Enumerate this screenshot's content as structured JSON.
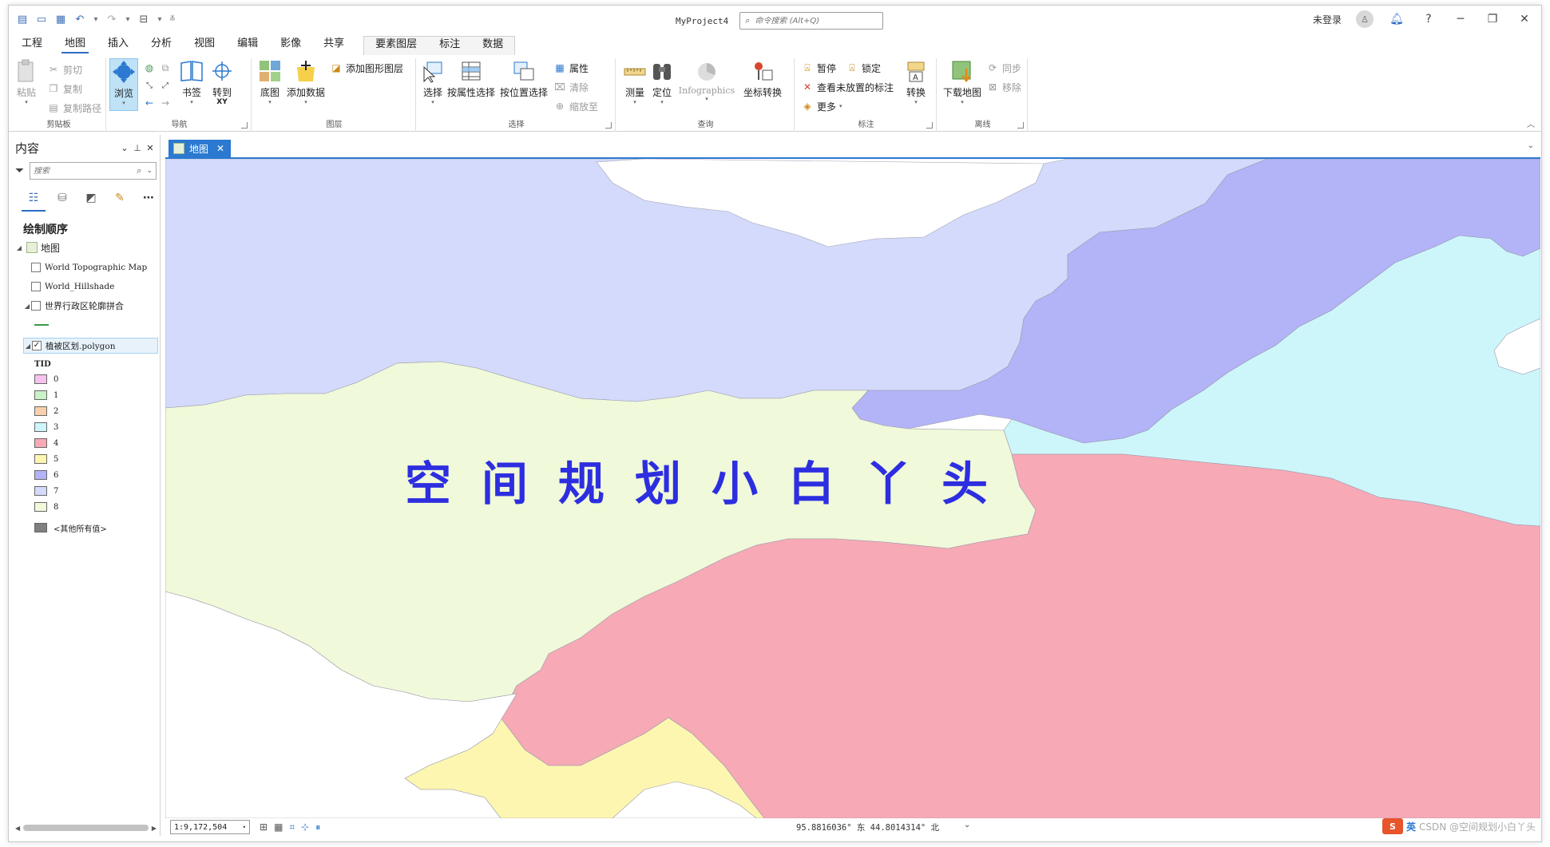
{
  "app": {
    "project_name": "MyProject4",
    "command_search_placeholder": "命令搜索 (Alt+Q)",
    "login_label": "未登录",
    "help": "?"
  },
  "tabs": [
    "工程",
    "地图",
    "插入",
    "分析",
    "视图",
    "编辑",
    "影像",
    "共享"
  ],
  "context_tabs": [
    "要素图层",
    "标注",
    "数据"
  ],
  "active_tab": "地图",
  "ribbon": {
    "clipboard": {
      "paste": "粘贴",
      "cut": "剪切",
      "copy": "复制",
      "copy_path": "复制路径",
      "label": "剪贴板"
    },
    "navigate": {
      "explore": "浏览",
      "bookmarks": "书签",
      "go_to_xy": "转到",
      "go_to_xy_sub": "XY",
      "label": "导航"
    },
    "layer": {
      "basemap": "底图",
      "add_data": "添加数据",
      "add_graphics_layer": "添加图形图层",
      "label": "图层"
    },
    "selection": {
      "select": "选择",
      "select_by_attributes": "按属性选择",
      "select_by_location": "按位置选择",
      "attributes": "属性",
      "clear": "清除",
      "zoom_to": "缩放至",
      "label": "选择"
    },
    "inquiry": {
      "measure": "测量",
      "locate": "定位",
      "infographics": "Infographics",
      "convert_coordinates": "坐标转换",
      "label": "查询"
    },
    "labeling": {
      "pause": "暂停",
      "lock": "锁定",
      "view_unplaced": "查看未放置的标注",
      "more": "更多",
      "convert": "转换",
      "label": "标注"
    },
    "offline": {
      "download_map": "下载地图",
      "sync": "同步",
      "remove": "移除",
      "label": "离线"
    }
  },
  "contents": {
    "title": "内容",
    "search_placeholder": "搜索",
    "section": "绘制顺序",
    "map_name": "地图",
    "layers": [
      {
        "name": "World Topographic Map",
        "checked": false
      },
      {
        "name": "World_Hillshade",
        "checked": false
      },
      {
        "name": "世界行政区轮廓拼合",
        "checked": false
      },
      {
        "name": "植被区划.polygon",
        "checked": true
      }
    ],
    "legend_field": "TID",
    "legend": [
      {
        "label": "0",
        "color": "#f6c3f0"
      },
      {
        "label": "1",
        "color": "#c9f2c7"
      },
      {
        "label": "2",
        "color": "#f9cfae"
      },
      {
        "label": "3",
        "color": "#cdf6fb"
      },
      {
        "label": "4",
        "color": "#f7a9b6"
      },
      {
        "label": "5",
        "color": "#fdf6b0"
      },
      {
        "label": "6",
        "color": "#b3b3f8"
      },
      {
        "label": "7",
        "color": "#d3dafb"
      },
      {
        "label": "8",
        "color": "#f0f9d9"
      }
    ],
    "other_values": "<其他所有值>",
    "other_color": "#808080"
  },
  "map": {
    "tab_label": "地图",
    "watermark": "空间规划小白丫头",
    "scale": "1:9,172,504",
    "coordinates": "95.8816036° 东  44.8014314° 北",
    "colors": {
      "region_7": "#d3dafb",
      "region_6": "#b3b3f8",
      "region_3": "#cdf6fb",
      "region_8": "#f0f9d9",
      "region_4": "#f7a9b6",
      "region_5": "#fdf6b0"
    }
  },
  "watermark_footer": "CSDN @空间规划小白丫头",
  "ime_label": "英"
}
